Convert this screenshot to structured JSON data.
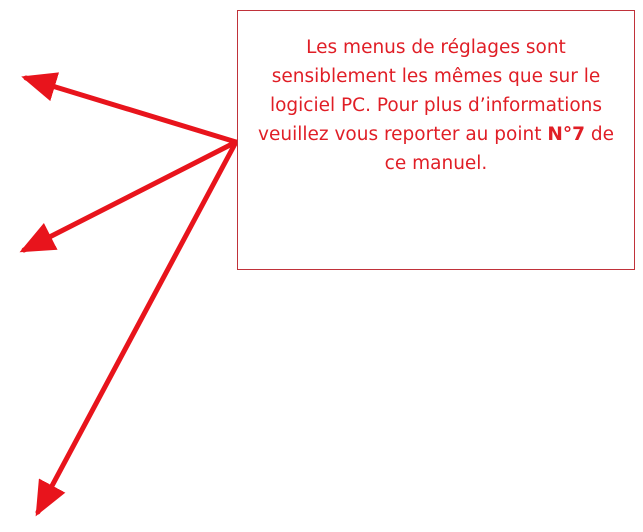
{
  "callout": {
    "text_before": "Les menus de réglages sont sensiblement les mêmes que sur le logiciel PC. Pour plus d’informations veuillez vous reporter au point ",
    "highlight": "N°7",
    "text_after": " de ce manuel."
  },
  "colors": {
    "text": "#e01e26",
    "arrow": "#e8141c",
    "border": "#c0323a",
    "background": "#ffffff"
  },
  "arrows": {
    "count": 3
  }
}
